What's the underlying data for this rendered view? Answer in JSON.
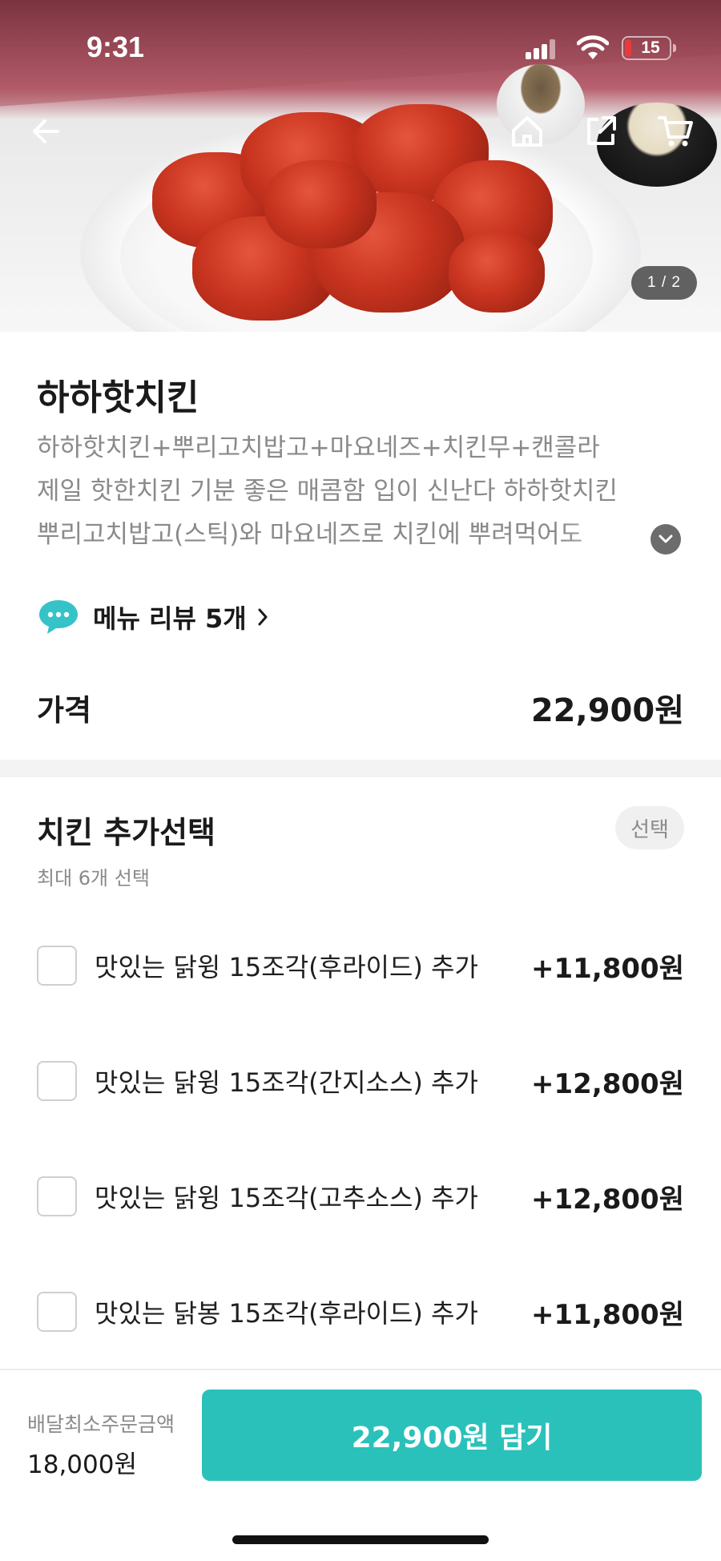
{
  "status_bar": {
    "time": "9:31",
    "battery": "15"
  },
  "hero": {
    "image_counter": "1 / 2"
  },
  "nav": {
    "back_icon": "arrow-left-icon",
    "home_icon": "home-icon",
    "share_icon": "share-icon",
    "cart_icon": "cart-icon"
  },
  "menu": {
    "title": "하하핫치킨",
    "description_lines": [
      "하하핫치킨+뿌리고치밥고+마요네즈+치킨무+캔콜라",
      "제일 핫한치킨 기분 좋은 매콤함 입이 신난다 하하핫치킨",
      " 뿌리고치밥고(스틱)와 마요네즈로 치킨에 뿌려먹어도"
    ],
    "review_label": "메뉴 리뷰 5개",
    "price_label": "가격",
    "price_value": "22,900원"
  },
  "addon_section": {
    "title": "치킨 추가선택",
    "subtitle": "최대 6개 선택",
    "badge": "선택",
    "options": [
      {
        "name": "맛있는 닭윙 15조각(후라이드) 추가",
        "price": "+11,800원",
        "checked": false
      },
      {
        "name": "맛있는 닭윙 15조각(간지소스) 추가",
        "price": "+12,800원",
        "checked": false
      },
      {
        "name": "맛있는 닭윙 15조각(고추소스) 추가",
        "price": "+12,800원",
        "checked": false
      },
      {
        "name": "맛있는 닭봉 15조각(후라이드) 추가",
        "price": "+11,800원",
        "checked": false
      }
    ]
  },
  "bottom_bar": {
    "min_order_label": "배달최소주문금액",
    "min_order_value": "18,000원",
    "cta_label": "22,900원 담기"
  },
  "colors": {
    "accent": "#2bc1bb",
    "chat_icon": "#35c3c8"
  }
}
